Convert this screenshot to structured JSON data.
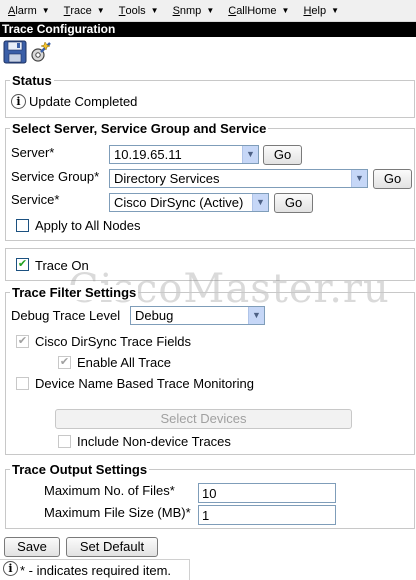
{
  "menu": [
    {
      "label": "Alarm",
      "ul": "A",
      "rest": "larm"
    },
    {
      "label": "Trace",
      "ul": "T",
      "rest": "race"
    },
    {
      "label": "Tools",
      "ul": "T",
      "rest": "ools"
    },
    {
      "label": "Snmp",
      "ul": "S",
      "rest": "nmp"
    },
    {
      "label": "CallHome",
      "ul": "C",
      "rest": "allHome"
    },
    {
      "label": "Help",
      "ul": "H",
      "rest": "elp"
    }
  ],
  "page_title": "Trace Configuration",
  "icons": {
    "save": "floppy-disk-icon",
    "settings": "gear-wand-icon",
    "info": "info-icon"
  },
  "status": {
    "legend": "Status",
    "message": "Update Completed"
  },
  "server_section": {
    "legend": "Select Server, Service Group and Service",
    "server_label": "Server*",
    "server_value": "10.19.65.11",
    "service_group_label": "Service Group*",
    "service_group_value": "Directory Services",
    "service_label": "Service*",
    "service_value": "Cisco DirSync (Active)",
    "go_label": "Go",
    "apply_all_label": "Apply to All Nodes",
    "apply_all_checked": false
  },
  "trace_on": {
    "label": "Trace On",
    "checked": true
  },
  "filter": {
    "legend": "Trace Filter Settings",
    "debug_level_label": "Debug Trace Level",
    "debug_level_value": "Debug",
    "dirsync_fields_label": "Cisco DirSync Trace Fields",
    "dirsync_fields_checked": true,
    "enable_all_label": "Enable All Trace",
    "enable_all_checked": true,
    "device_monitoring_label": "Device Name Based Trace Monitoring",
    "device_monitoring_checked": false,
    "select_devices_label": "Select Devices",
    "non_device_label": "Include Non-device Traces",
    "non_device_checked": false
  },
  "output": {
    "legend": "Trace Output Settings",
    "max_files_label": "Maximum No. of Files*",
    "max_files_value": "10",
    "max_size_label": "Maximum File Size (MB)*",
    "max_size_value": "1"
  },
  "buttons": {
    "save": "Save",
    "set_default": "Set Default"
  },
  "footnote": "* - indicates required item.",
  "watermark": "CiscoMaster.ru",
  "colors": {
    "titlebar_bg": "#000000",
    "check_green": "#21a121",
    "arrow_bg": "#c6d7f7"
  }
}
